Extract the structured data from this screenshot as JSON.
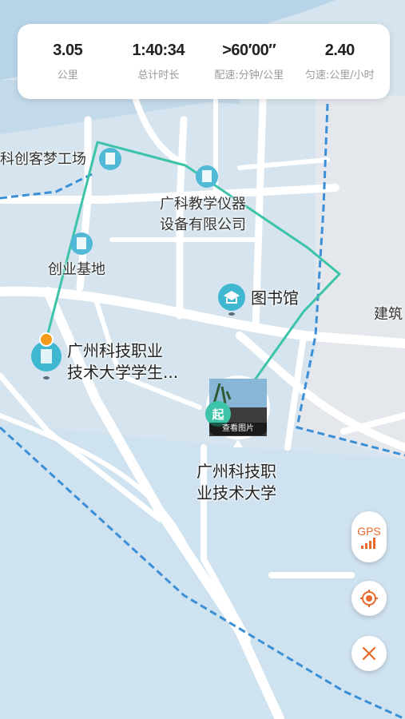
{
  "stats": [
    {
      "value": "3.05",
      "label": "公里"
    },
    {
      "value": "1:40:34",
      "label": "总计时长"
    },
    {
      "value": ">60′00″",
      "label": "配速:分钟/公里"
    },
    {
      "value": "2.40",
      "label": "匀速:公里/小时"
    }
  ],
  "pois": {
    "maker_factory": "科创客梦工场",
    "instrument_line1": "广科教学仪器",
    "instrument_line2": "设备有限公司",
    "startup_base": "创业基地",
    "library": "图书馆",
    "building": "建筑",
    "student_line1": "广州科技职业",
    "student_line2": "技术大学学生...",
    "university_line1": "广州科技职",
    "university_line2": "业技术大学"
  },
  "start_marker": {
    "label": "起",
    "photo_text": "查看图片"
  },
  "controls": {
    "gps_label": "GPS"
  },
  "colors": {
    "route": "#3cc3a8",
    "accent": "#e8692a",
    "road": "#ffffff",
    "block": "#d7e6f0",
    "boundary": "#3b8fd6"
  }
}
